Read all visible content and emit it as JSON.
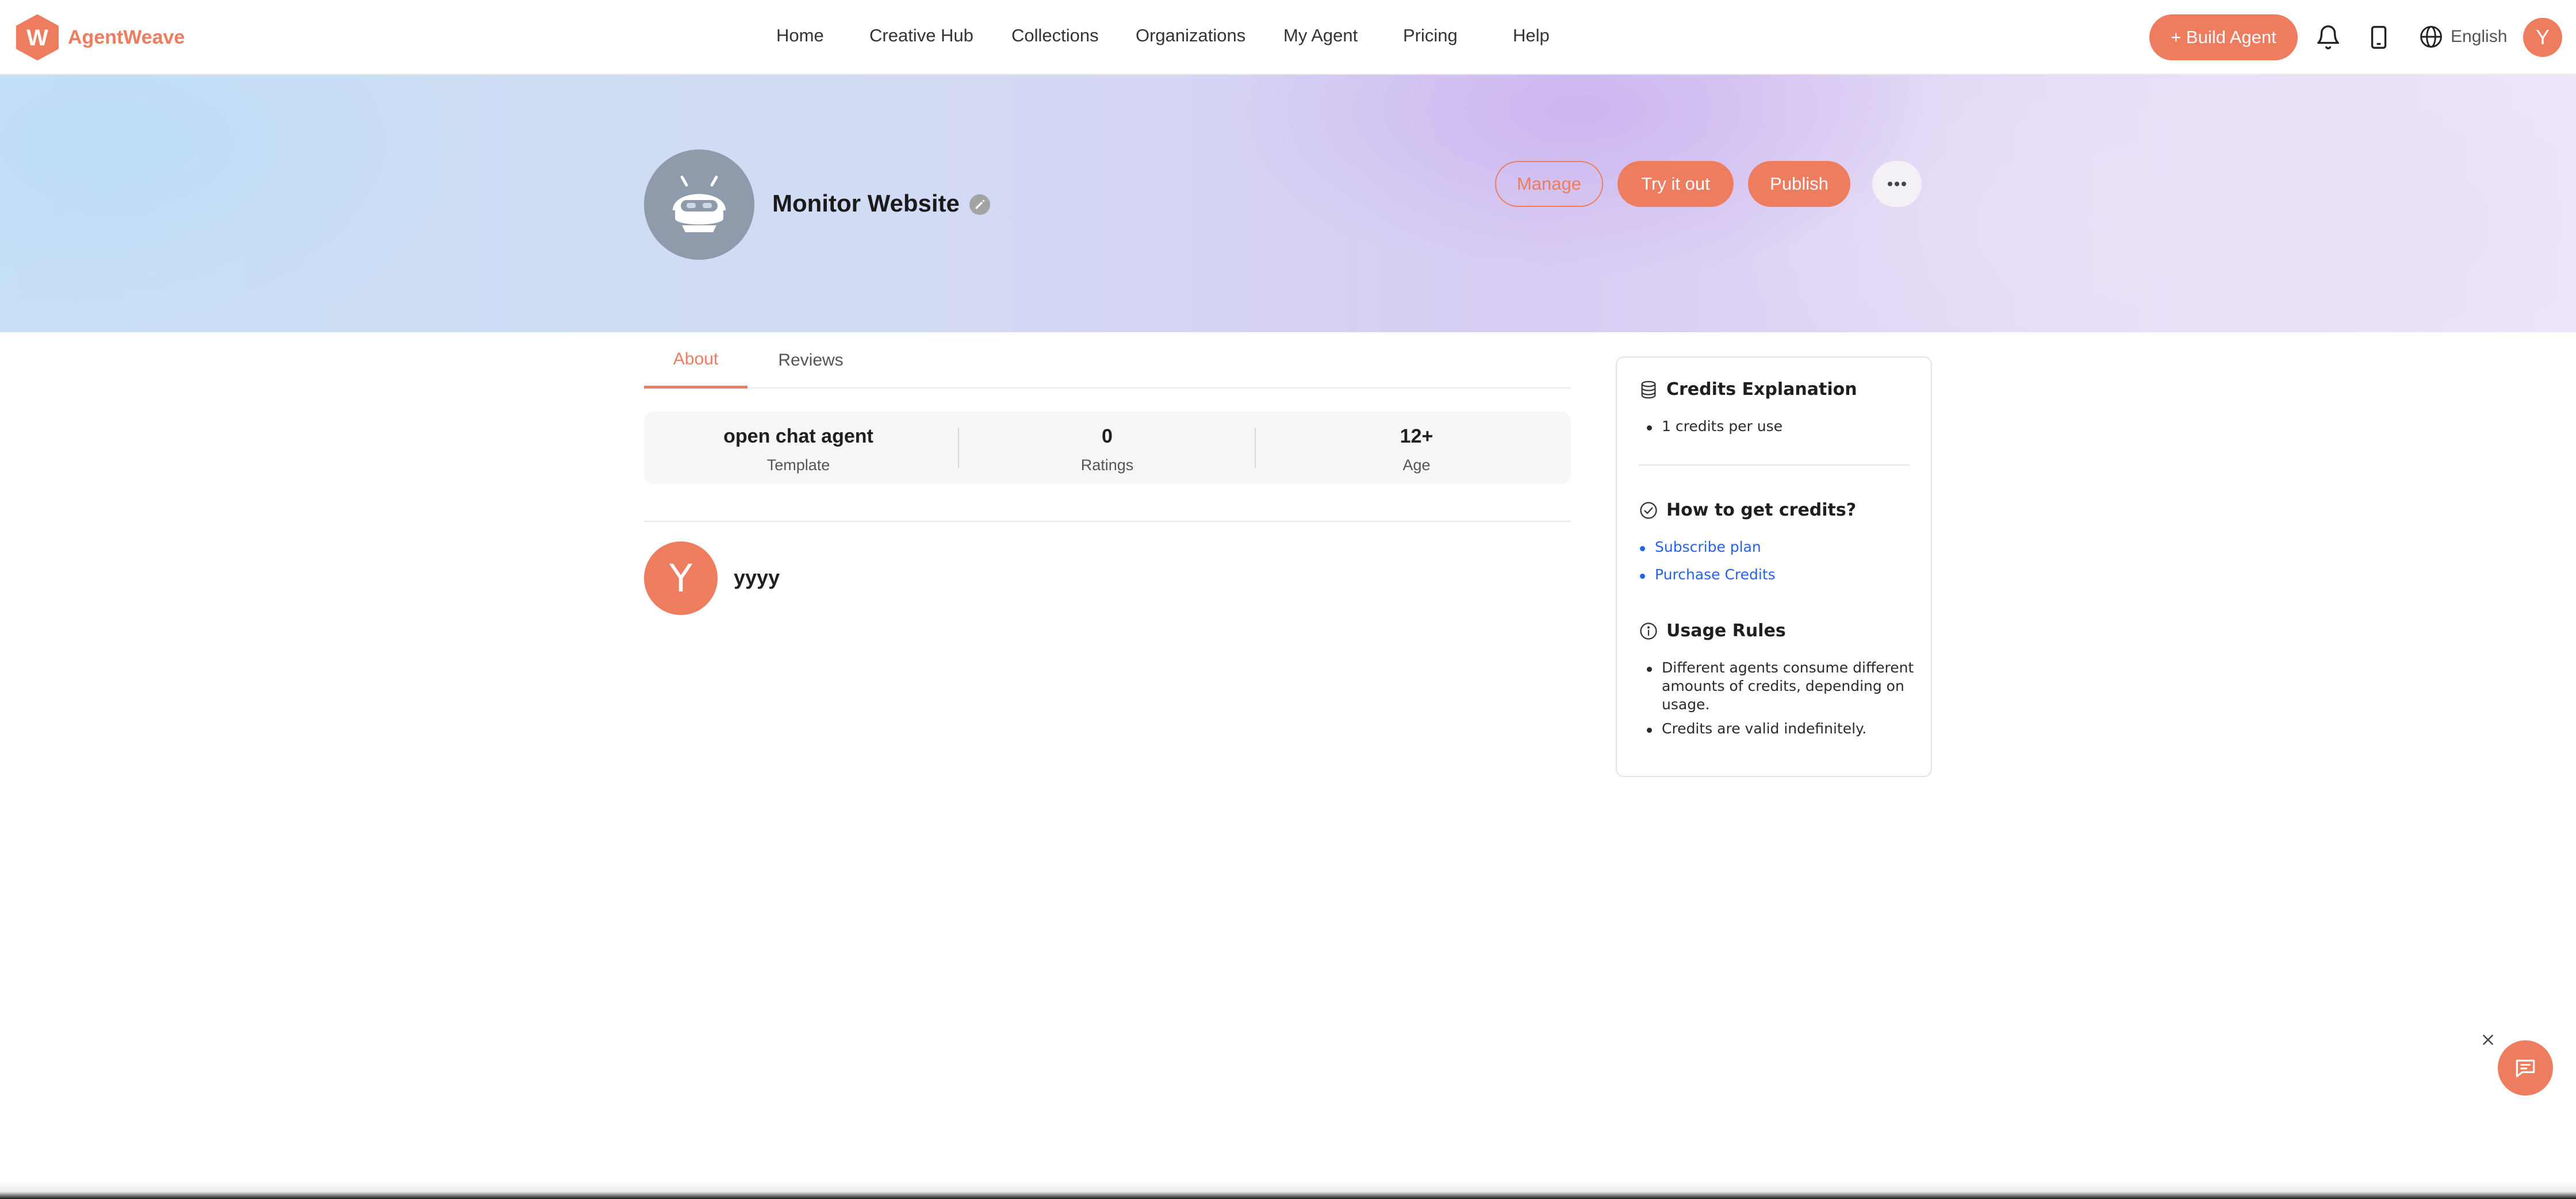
{
  "brand": {
    "name": "AgentWeave",
    "logo_letter": "W",
    "accent_color": "#ee7c5f"
  },
  "nav": {
    "items": [
      {
        "label": "Home"
      },
      {
        "label": "Creative Hub"
      },
      {
        "label": "Collections"
      },
      {
        "label": "Organizations"
      },
      {
        "label": "My Agent"
      },
      {
        "label": "Pricing"
      },
      {
        "label": "Help"
      }
    ],
    "build_label": "+ Build Agent",
    "language": "English",
    "user_initial": "Y",
    "icons": [
      "bell-icon",
      "mobile-icon",
      "globe-icon"
    ]
  },
  "agent": {
    "title": "Monitor Website",
    "actions": {
      "manage": "Manage",
      "try": "Try it out",
      "publish": "Publish",
      "more": "···"
    }
  },
  "tabs": [
    {
      "label": "About",
      "active": true
    },
    {
      "label": "Reviews",
      "active": false
    }
  ],
  "stats": [
    {
      "value": "open chat agent",
      "label": "Template"
    },
    {
      "value": "0",
      "label": "Ratings"
    },
    {
      "value": "12+",
      "label": "Age"
    }
  ],
  "creator": {
    "initial": "Y",
    "name": "yyyy"
  },
  "credits": {
    "explanation": {
      "title": "Credits Explanation",
      "items": [
        "1 credits per use"
      ]
    },
    "how_to": {
      "title": "How to get credits?",
      "links": [
        "Subscribe plan",
        "Purchase Credits"
      ]
    },
    "rules": {
      "title": "Usage Rules",
      "items": [
        "Different agents consume different amounts of credits, depending on usage.",
        "Credits are valid indefinitely."
      ]
    }
  }
}
